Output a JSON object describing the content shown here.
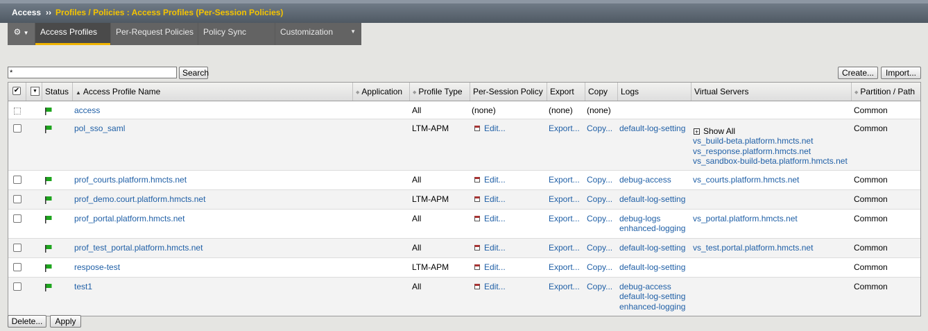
{
  "breadcrumb": {
    "root": "Access",
    "separator": "››",
    "path": "Profiles / Policies : Access Profiles (Per-Session Policies)"
  },
  "tabs": [
    {
      "label": "Access Profiles",
      "active": true
    },
    {
      "label": "Per-Request Policies"
    },
    {
      "label": "Policy Sync"
    },
    {
      "label": "Customization"
    }
  ],
  "toolbar": {
    "search_value": "*",
    "search_label": "Search",
    "create_label": "Create...",
    "import_label": "Import..."
  },
  "columns": {
    "status": "Status",
    "name": "Access Profile Name",
    "application": "Application",
    "profile_type": "Profile Type",
    "policy": "Per-Session Policy",
    "export": "Export",
    "copy": "Copy",
    "logs": "Logs",
    "virtual_servers": "Virtual Servers",
    "partition": "Partition / Path"
  },
  "rows": [
    {
      "name": "access",
      "type": "All",
      "policy": "(none)",
      "export": "(none)",
      "copy": "(none)",
      "logs": [],
      "vs": [],
      "partition": "Common"
    },
    {
      "name": "pol_sso_saml",
      "type": "LTM-APM",
      "policy": "Edit...",
      "export": "Export...",
      "copy": "Copy...",
      "logs": [
        "default-log-setting"
      ],
      "vs_show_all": "Show All",
      "vs": [
        "vs_build-beta.platform.hmcts.net",
        "vs_response.platform.hmcts.net",
        "vs_sandbox-build-beta.platform.hmcts.net"
      ],
      "partition": "Common"
    },
    {
      "name": "prof_courts.platform.hmcts.net",
      "type": "All",
      "policy": "Edit...",
      "export": "Export...",
      "copy": "Copy...",
      "logs": [
        "debug-access"
      ],
      "vs": [
        "vs_courts.platform.hmcts.net"
      ],
      "partition": "Common"
    },
    {
      "name": "prof_demo.court.platform.hmcts.net",
      "type": "LTM-APM",
      "policy": "Edit...",
      "export": "Export...",
      "copy": "Copy...",
      "logs": [
        "default-log-setting"
      ],
      "vs": [],
      "partition": "Common"
    },
    {
      "name": "prof_portal.platform.hmcts.net",
      "type": "All",
      "policy": "Edit...",
      "export": "Export...",
      "copy": "Copy...",
      "logs": [
        "debug-logs",
        "enhanced-logging"
      ],
      "vs": [
        "vs_portal.platform.hmcts.net"
      ],
      "partition": "Common"
    },
    {
      "name": "prof_test_portal.platform.hmcts.net",
      "type": "All",
      "policy": "Edit...",
      "export": "Export...",
      "copy": "Copy...",
      "logs": [
        "default-log-setting"
      ],
      "vs": [
        "vs_test.portal.platform.hmcts.net"
      ],
      "partition": "Common"
    },
    {
      "name": "respose-test",
      "type": "LTM-APM",
      "policy": "Edit...",
      "export": "Export...",
      "copy": "Copy...",
      "logs": [
        "default-log-setting"
      ],
      "vs": [],
      "partition": "Common"
    },
    {
      "name": "test1",
      "type": "All",
      "policy": "Edit...",
      "export": "Export...",
      "copy": "Copy...",
      "logs": [
        "debug-access",
        "default-log-setting",
        "enhanced-logging"
      ],
      "vs": [],
      "partition": "Common"
    }
  ],
  "footer": {
    "delete_label": "Delete...",
    "apply_label": "Apply"
  }
}
